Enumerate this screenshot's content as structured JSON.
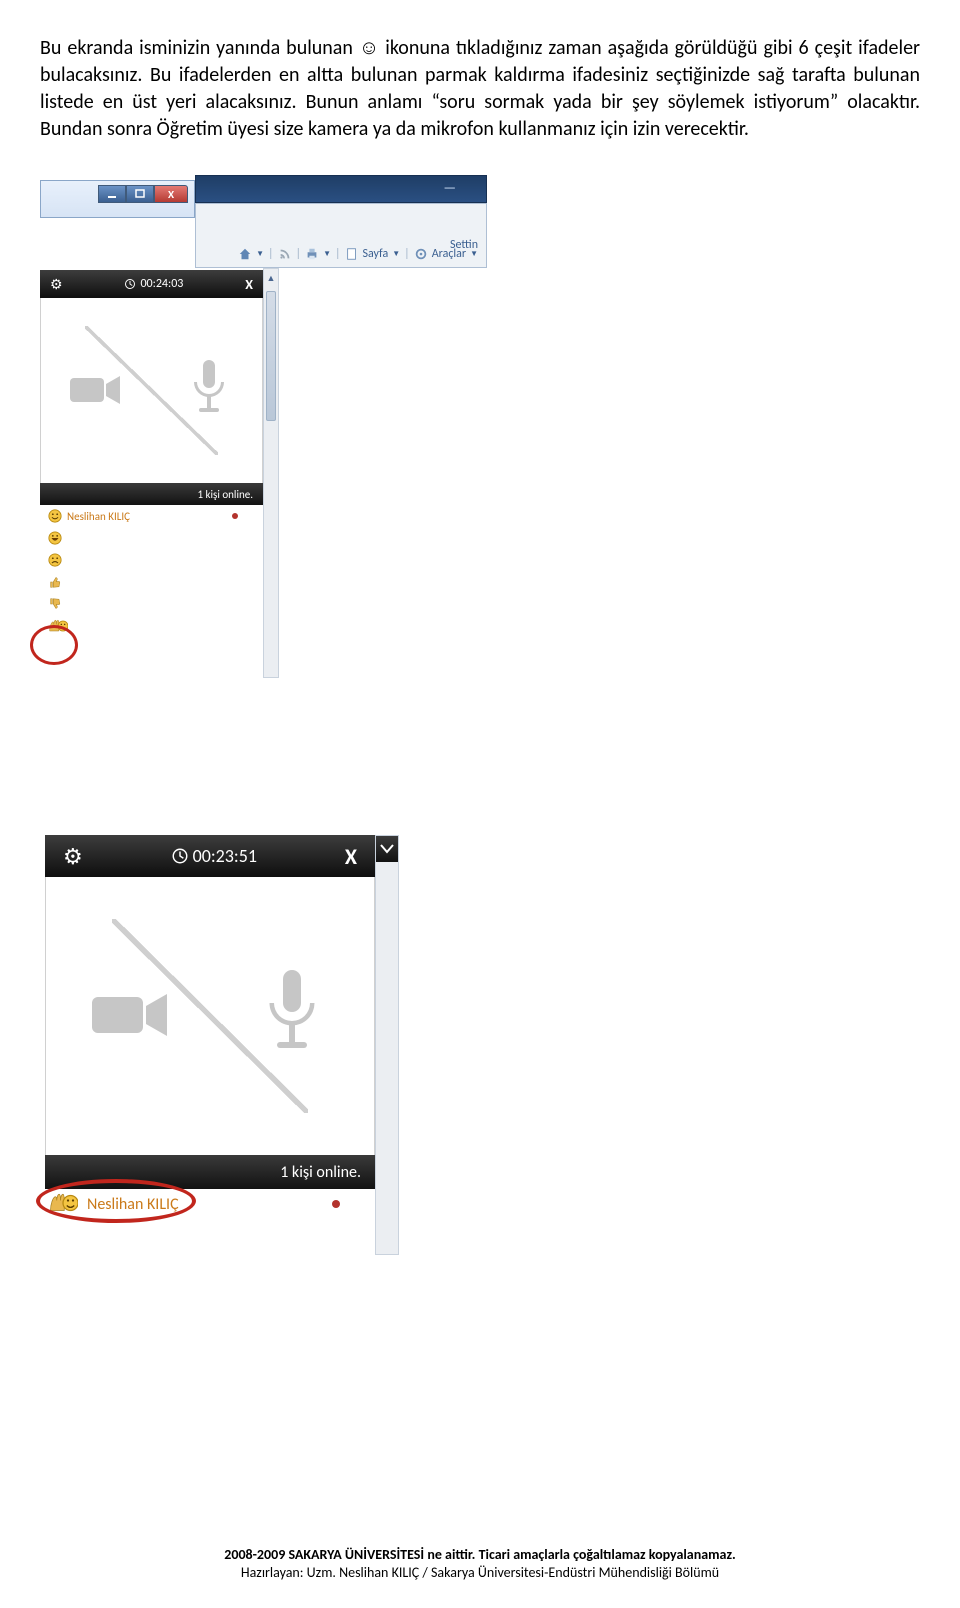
{
  "doc": {
    "paragraph": "Bu ekranda isminizin yanında bulunan ☺ ikonuna tıkladığınız zaman aşağıda görüldüğü gibi 6 çeşit ifadeler bulacaksınız. Bu ifadelerden en altta bulunan parmak kaldırma ifadesiniz seçtiğinizde sağ tarafta bulunan listede en üst yeri alacaksınız. Bunun anlamı “soru sormak yada bir şey söylemek istiyorum” olacaktır. Bundan sonra Öğretim üyesi size kamera ya da mikrofon kullanmanız için izin verecektir."
  },
  "shot1": {
    "win_close": "X",
    "setting": "Settin",
    "sayfa": "Sayfa",
    "araclar": "Araçlar",
    "timer": "00:24:03",
    "player_x": "X",
    "online": "1 kişi online.",
    "user": "Neslihan KILIÇ"
  },
  "shot2": {
    "timer": "00:23:51",
    "player_x": "X",
    "online": "1 kişi online.",
    "user": "Neslihan KILIÇ"
  },
  "footer": {
    "line1": "2008-2009 SAKARYA ÜNİVERSİTESİ ne aittir. Ticari amaçlarla çoğaltılamaz kopyalanamaz.",
    "line2": "Hazırlayan: Uzm. Neslihan KILIÇ / Sakarya Üniversitesi-Endüstri Mühendisliği Bölümü"
  }
}
